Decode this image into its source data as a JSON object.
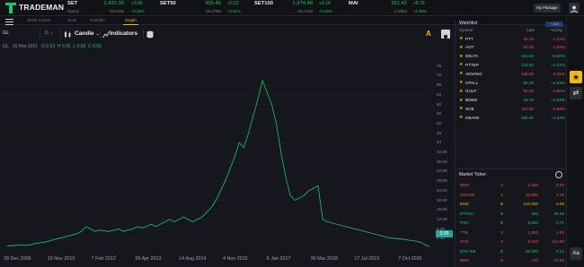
{
  "app": {
    "name": "TRADEMAN"
  },
  "indices": [
    {
      "name": "SET",
      "sub": "Open2",
      "value": "1,431.30",
      "volume": "78,019M",
      "change": "+3.66",
      "pct": "+0.26%"
    },
    {
      "name": "SET50",
      "sub": "",
      "value": "905.46",
      "volume": "55,178M",
      "change": "+0.12",
      "pct": "+0.01%"
    },
    {
      "name": "SET100",
      "sub": "",
      "value": "1,974.48",
      "volume": "66,474M",
      "change": "+3.14",
      "pct": "+0.16%"
    },
    {
      "name": "MAI",
      "sub": "",
      "value": "351.42",
      "volume": "1,336M",
      "change": "+6.76",
      "pct": "+1.96%"
    }
  ],
  "header": {
    "package_label": "My Package"
  },
  "nav": {
    "tabs": [
      "Stock Center",
      "Scan",
      "Portfolio",
      "Graph"
    ],
    "active": "Graph"
  },
  "toolbar": {
    "symbol": "GL",
    "interval": "D",
    "chart_type": "Candle",
    "indicators": "Indicators",
    "auto": "A"
  },
  "ohlc": {
    "symbol": "GL",
    "date": "16 Mar 2021",
    "o_label": "O",
    "o": "0.63",
    "h_label": "H",
    "h": "0.65",
    "l_label": "L",
    "l": "0.56",
    "c_label": "C",
    "c": "0.65"
  },
  "chart_data": {
    "type": "line",
    "title": "",
    "xlabel": "",
    "ylabel": "",
    "y_ticks": [
      "76",
      "72",
      "68",
      "64",
      "60",
      "56",
      "52",
      "48",
      "44",
      "40.00",
      "36.00",
      "32.00",
      "28.00",
      "24.00",
      "20.00",
      "16.00",
      "12.00",
      "8.00",
      "4.00"
    ],
    "x_ticks": [
      "28 Dec 2006",
      "15 Nov 2010",
      "7 Feb 2012",
      "29 Apr 2013",
      "14 Aug 2014",
      "4 Nov 2015",
      "6 Jan 2017",
      "30 Mar 2018",
      "17 Jul 2019",
      "7 Oct 2020"
    ],
    "ylim": [
      0,
      80
    ],
    "last_price": "0.65",
    "series": [
      {
        "values": [
          1,
          1,
          1.2,
          1.3,
          1.2,
          1.4,
          2,
          2.2,
          2.5,
          3,
          3.5,
          4,
          4.5,
          5,
          5.5,
          6,
          7,
          9,
          8,
          7,
          7.5,
          7.2,
          7,
          7.5,
          8,
          7,
          7.5,
          8,
          9,
          8.5,
          9,
          10,
          9,
          10,
          11,
          12,
          11,
          12,
          13,
          12,
          11,
          12,
          13,
          15,
          17,
          20,
          24,
          28,
          33,
          38,
          44,
          42,
          48,
          55,
          62,
          70,
          65,
          60,
          52,
          40,
          30,
          22,
          20,
          21,
          22,
          24,
          25,
          26,
          12,
          11,
          10.5,
          10,
          9.5,
          9,
          8.5,
          8,
          7.5,
          7,
          6.5,
          6,
          5.5,
          5,
          4.5,
          4.2,
          4,
          3.8,
          3.5,
          3.2,
          3,
          2.5,
          1.5,
          0.65
        ]
      }
    ]
  },
  "watchlist": {
    "title": "Watchlist",
    "add_label": "+ Add",
    "columns": [
      "Symbol",
      "Last",
      "%Chg"
    ],
    "rows": [
      {
        "symbol": "PTT",
        "last": "34.25",
        "pct": "-1.44%",
        "dir": "down"
      },
      {
        "symbol": "AOT",
        "last": "62.25",
        "pct": "-1.58%",
        "dir": "down"
      },
      {
        "symbol": "DELTA",
        "last": "101.50",
        "pct": "+0.50%",
        "dir": "up"
      },
      {
        "symbol": "PTTEP",
        "last": "143.50",
        "pct": "+1.41%",
        "dir": "up"
      },
      {
        "symbol": "ADVANC",
        "last": "160.00",
        "pct": "-3.35%",
        "dir": "down"
      },
      {
        "symbol": "CPALL",
        "last": "66.25",
        "pct": "+1.53%",
        "dir": "up"
      },
      {
        "symbol": "GULF",
        "last": "55.25",
        "pct": "-0.90%",
        "dir": "down"
      },
      {
        "symbol": "BDMS",
        "last": "19.75",
        "pct": "+2.59%",
        "dir": "up"
      },
      {
        "symbol": "SCB",
        "last": "112.50",
        "pct": "-0.88%",
        "dir": "down"
      },
      {
        "symbol": "KBANK",
        "last": "155.00",
        "pct": "+1.64%",
        "dir": "up"
      }
    ]
  },
  "ticker": {
    "title": "Market Ticker",
    "rows": [
      {
        "symbol": "BEM",
        "side": "S",
        "volume": "1,000",
        "price": "8.00",
        "color": "#ef4f4f"
      },
      {
        "symbol": "DEXON",
        "side": "S",
        "volume": "20,000",
        "price": "1.76",
        "color": "#ef4f4f"
      },
      {
        "symbol": "EMC",
        "side": "B",
        "volume": "104,000",
        "price": "0.09",
        "color": "#f0b90b"
      },
      {
        "symbol": "PTTGC",
        "side": "B",
        "volume": "400",
        "price": "28.25",
        "color": "#21c46b"
      },
      {
        "symbol": "PSG",
        "side": "B",
        "volume": "5,000",
        "price": "0.71",
        "color": "#21c46b"
      },
      {
        "symbol": "TTB",
        "side": "S",
        "volume": "1,900",
        "price": "2.00",
        "color": "#ef4f4f"
      },
      {
        "symbol": "SCB",
        "side": "S",
        "volume": "5,000",
        "price": "112.50",
        "color": "#ef4f4f"
      },
      {
        "symbol": "BTS-W8",
        "side": "B",
        "volume": "90,000",
        "price": "0.12",
        "color": "#21c46b"
      },
      {
        "symbol": "BBIK",
        "side": "B",
        "volume": "100",
        "price": "37.50",
        "color": "#ef4f4f"
      }
    ]
  },
  "rail": {
    "font_label": "Aa"
  },
  "colors": {
    "up": "#21c46b",
    "down": "#ef4f4f",
    "accent": "#f0b90b",
    "line": "#21c46b"
  }
}
